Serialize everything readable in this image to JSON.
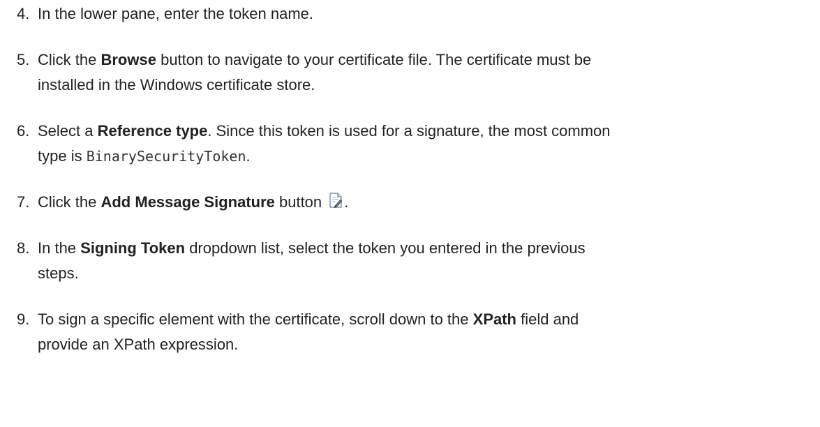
{
  "steps": [
    {
      "number": "4.",
      "text": "In the lower pane, enter the token name."
    },
    {
      "number": "5.",
      "pre": "Click the ",
      "bold": "Browse",
      "post_line1": " button to navigate to your certificate file. The certificate must be",
      "line2": "installed in the Windows certificate store."
    },
    {
      "number": "6.",
      "pre": "Select a ",
      "bold": "Reference type",
      "post_line1": ". Since this token is used for a signature, the most common",
      "line2_pre": "type is ",
      "code": "BinarySecurityToken",
      "line2_post": "."
    },
    {
      "number": "7.",
      "pre": "Click the ",
      "bold": "Add Message Signature",
      "post": " button ",
      "icon": "add-message-signature-icon",
      "end": "."
    },
    {
      "number": "8.",
      "pre": "In the ",
      "bold": "Signing Token",
      "post_line1": " dropdown list, select the token you entered in the previous",
      "line2": "steps."
    },
    {
      "number": "9.",
      "pre": "To sign a specific element with the certificate, scroll down to the ",
      "bold": "XPath",
      "post_line1": " field and",
      "line2": "provide an XPath expression."
    }
  ]
}
